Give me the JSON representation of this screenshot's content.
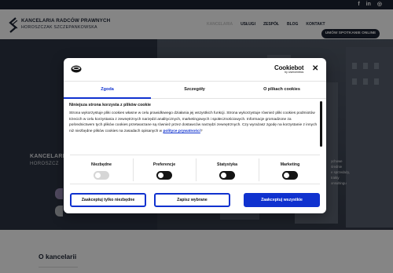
{
  "social": {
    "facebook": "f",
    "linkedin": "in",
    "instagram": "◎"
  },
  "brand": {
    "name": "KANCELARIA RADCÓW PRAWNYCH",
    "subname": "HOROSZCZAK SZCZEPANKOWSKA"
  },
  "menu": {
    "items": [
      "KANCELARIA",
      "USŁUGI",
      "ZESPÓŁ",
      "BLOG",
      "KONTAKT"
    ],
    "active": "KANCELARIA",
    "cta": "UMÓW SPOTKANIE ONLINE"
  },
  "hero": {
    "title": "KANCELARIA",
    "subtitle": "HOROSZCZ",
    "text": "ychowe\nśrednie\ne sprzedaży,\ntrakty\nonsultingu"
  },
  "about": {
    "title": "O kancelarii"
  },
  "cookie": {
    "brand_name": "Cookiebot",
    "brand_sub": "by Usercentrics",
    "close": "✕",
    "tabs": [
      "Zgoda",
      "Szczegóły",
      "O plikach cookies"
    ],
    "active_tab": "Zgoda",
    "heading": "Niniejsza strona korzysta z plików cookie",
    "body": "Strona wykorzystuje pliki cookies własne w celu prawidłowego działania jej wszystkich funkcji. Strona wykorzystuje również pliki cookies podmiotów trzecich w celu korzystania z zewnętrznych narzędzi analitycznych, marketingowych i społecznościowych. Informacje gromadzone za pośrednictwem tych plików cookies przetwarzane są również przez dostawców narzędzi zewnętrznych. Czy wyrażasz zgodę na korzystanie z innych niż niezbędne plików cookies na zasadach opisanych w ",
    "policy_link": "polityce prywatności",
    "body_end": "?",
    "toggles": [
      {
        "label": "Niezbędne",
        "state": "disabled"
      },
      {
        "label": "Preferencje",
        "state": "off"
      },
      {
        "label": "Statystyka",
        "state": "off"
      },
      {
        "label": "Marketing",
        "state": "off"
      }
    ],
    "buttons": {
      "necessary": "Zaakceptuj tylko niezbędne",
      "save": "Zapisz wybrane",
      "accept_all": "Zaakceptuj wszystkie"
    }
  },
  "colors": {
    "navy": "#1b2333",
    "accent": "#1032cf",
    "text": "#141414"
  }
}
